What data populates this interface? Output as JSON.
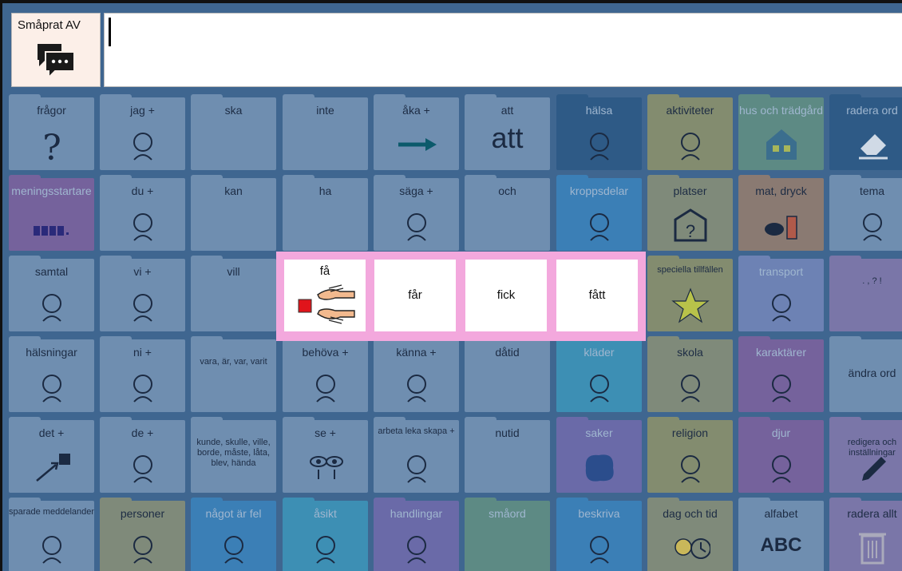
{
  "topbar": {
    "chat_toggle_label": "Småprat AV",
    "chat_icon": "speech-bubbles-icon",
    "message_text": ""
  },
  "colors": {
    "overlay": "#3f6690",
    "popup_border": "#f3a8dd",
    "selected_square": "#e0141b"
  },
  "grid": {
    "rows": [
      [
        {
          "label": "frågor",
          "style": "pale",
          "icon": "question-mark-icon",
          "symbol": "?"
        },
        {
          "label": "jag +",
          "style": "pale",
          "icon": "person-pointing-self-icon"
        },
        {
          "label": "ska",
          "style": "pale",
          "icon": ""
        },
        {
          "label": "inte",
          "style": "pale",
          "icon": ""
        },
        {
          "label": "åka +",
          "style": "pale",
          "icon": "arrow-right-icon"
        },
        {
          "label": "att",
          "style": "pale",
          "icon": "",
          "symbol": "att"
        },
        {
          "label": "hälsa",
          "style": "dark",
          "icon": "caduceus-icon"
        },
        {
          "label": "aktiviteter",
          "style": "olive",
          "icon": "activities-icon"
        },
        {
          "label": "hus och trädgård",
          "style": "teal",
          "icon": "house-icon"
        },
        {
          "label": "radera ord",
          "style": "dark",
          "icon": "eraser-icon"
        }
      ],
      [
        {
          "label": "meningsstartare",
          "style": "mag",
          "icon": "sentence-blocks-icon"
        },
        {
          "label": "du +",
          "style": "pale",
          "icon": "pointing-hand-icon"
        },
        {
          "label": "kan",
          "style": "pale",
          "icon": ""
        },
        {
          "label": "ha",
          "style": "pale",
          "icon": ""
        },
        {
          "label": "säga +",
          "style": "pale",
          "icon": "speaking-face-icon"
        },
        {
          "label": "och",
          "style": "pale",
          "icon": ""
        },
        {
          "label": "kroppsdelar",
          "style": "blue2",
          "icon": "body-parts-icon"
        },
        {
          "label": "platser",
          "style": "tan",
          "icon": "place-question-icon"
        },
        {
          "label": "mat, dryck",
          "style": "orange",
          "icon": "food-drink-icon"
        },
        {
          "label": "tema",
          "style": "pale",
          "icon": "theme-map-icon"
        }
      ],
      [
        {
          "label": "samtal",
          "style": "pale",
          "icon": "talking-head-icon"
        },
        {
          "label": "vi +",
          "style": "pale",
          "icon": "we-faces-icon"
        },
        {
          "label": "vill",
          "style": "pale",
          "icon": ""
        },
        {
          "label": "",
          "style": "pale",
          "icon": ""
        },
        {
          "label": "",
          "style": "pale",
          "icon": ""
        },
        {
          "label": "",
          "style": "pale",
          "icon": ""
        },
        {
          "label": "",
          "style": "pale",
          "icon": ""
        },
        {
          "label": "speciella tillfällen",
          "style": "olive",
          "icon": "star-icon"
        },
        {
          "label": "transport",
          "style": "lightlav",
          "icon": "transport-icon"
        },
        {
          "label": ". , ? !",
          "style": "lav",
          "icon": ""
        }
      ],
      [
        {
          "label": "hälsningar",
          "style": "pale",
          "icon": "greeting-person-icon"
        },
        {
          "label": "ni +",
          "style": "pale",
          "icon": "you-plural-faces-icon"
        },
        {
          "label": "vara, är, var, varit",
          "style": "pale",
          "icon": ""
        },
        {
          "label": "behöva +",
          "style": "pale",
          "icon": "need-hand-icon"
        },
        {
          "label": "känna +",
          "style": "pale",
          "icon": "feeling-faces-icon"
        },
        {
          "label": "dåtid",
          "style": "pale",
          "icon": ""
        },
        {
          "label": "kläder",
          "style": "cyan",
          "icon": "clothes-icon"
        },
        {
          "label": "skola",
          "style": "tan",
          "icon": "school-icon"
        },
        {
          "label": "karaktärer",
          "style": "mag",
          "icon": "characters-icon"
        },
        {
          "label": "ändra ord",
          "style": "pale",
          "icon": ""
        }
      ],
      [
        {
          "label": "det +",
          "style": "pale",
          "icon": "arrow-to-square-icon"
        },
        {
          "label": "de +",
          "style": "pale",
          "icon": "arrow-to-faces-icon"
        },
        {
          "label": "kunde, skulle, ville, borde, måste, låta, blev, hända",
          "style": "pale",
          "icon": ""
        },
        {
          "label": "se +",
          "style": "pale",
          "icon": "eyes-icon"
        },
        {
          "label": "arbeta leka skapa +",
          "style": "pale",
          "icon": "working-hand-icon"
        },
        {
          "label": "nutid",
          "style": "pale",
          "icon": ""
        },
        {
          "label": "saker",
          "style": "purple",
          "icon": "blob-icon"
        },
        {
          "label": "religion",
          "style": "olive",
          "icon": "religion-icon"
        },
        {
          "label": "djur",
          "style": "mag",
          "icon": "animals-icon"
        },
        {
          "label": "redigera och inställningar",
          "style": "lav",
          "icon": "pencil-icon"
        }
      ],
      [
        {
          "label": "sparade meddelanden",
          "style": "pale",
          "icon": "saved-note-icon"
        },
        {
          "label": "personer",
          "style": "tan",
          "icon": "people-icon"
        },
        {
          "label": "något är fel",
          "style": "blue2",
          "icon": "sad-face-icon"
        },
        {
          "label": "åsikt",
          "style": "cyan",
          "icon": "opinion-person-icon"
        },
        {
          "label": "handlingar",
          "style": "purple",
          "icon": "actions-icon"
        },
        {
          "label": "småord",
          "style": "teal",
          "icon": ""
        },
        {
          "label": "beskriva",
          "style": "blue2",
          "icon": "describe-icon"
        },
        {
          "label": "dag och tid",
          "style": "tan",
          "icon": "sun-clock-icon"
        },
        {
          "label": "alfabet",
          "style": "pale",
          "icon": "",
          "symbol": "ABC"
        },
        {
          "label": "radera allt",
          "style": "lav",
          "icon": "trash-icon"
        }
      ]
    ]
  },
  "popup": {
    "items": [
      {
        "label": "få",
        "icon": "two-hands-red-square-icon"
      },
      {
        "label": "får"
      },
      {
        "label": "fick"
      },
      {
        "label": "fått"
      }
    ]
  }
}
